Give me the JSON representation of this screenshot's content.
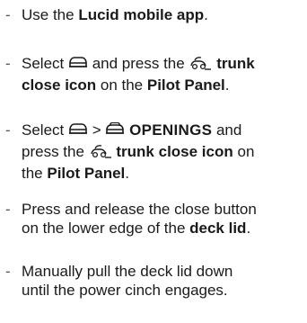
{
  "instructions": [
    {
      "pre": "Use the ",
      "bold": "Lucid mobile app",
      "post": "."
    },
    {
      "pre": "Select ",
      "mid": " and press the ",
      "bold1": "trunk",
      "bold2": "close icon",
      "mid2": " on the ",
      "bold3": "Pilot Panel",
      "post": ".",
      "icons": [
        "car-front-icon",
        "trunk-close-icon"
      ]
    },
    {
      "pre": "Select ",
      "sep": " > ",
      "openings": "OPENINGS",
      "post_openings": " and",
      "line2_pre": "press the ",
      "bold1": "trunk close icon",
      "line2_post": " on",
      "line3_pre": "the ",
      "bold2": "Pilot Panel",
      "post": ".",
      "icons": [
        "car-front-icon",
        "car-openings-icon",
        "trunk-close-icon"
      ]
    },
    {
      "line1": "Press and release the close button",
      "line2_pre": "on the lower edge of the ",
      "bold": "deck lid",
      "post": "."
    },
    {
      "line1": "Manually pull the deck lid down",
      "line2": "until the power cinch engages."
    }
  ],
  "bullet_symbol": "-",
  "colors": {
    "text": "#1a1a1a",
    "bullet": "#555555"
  }
}
